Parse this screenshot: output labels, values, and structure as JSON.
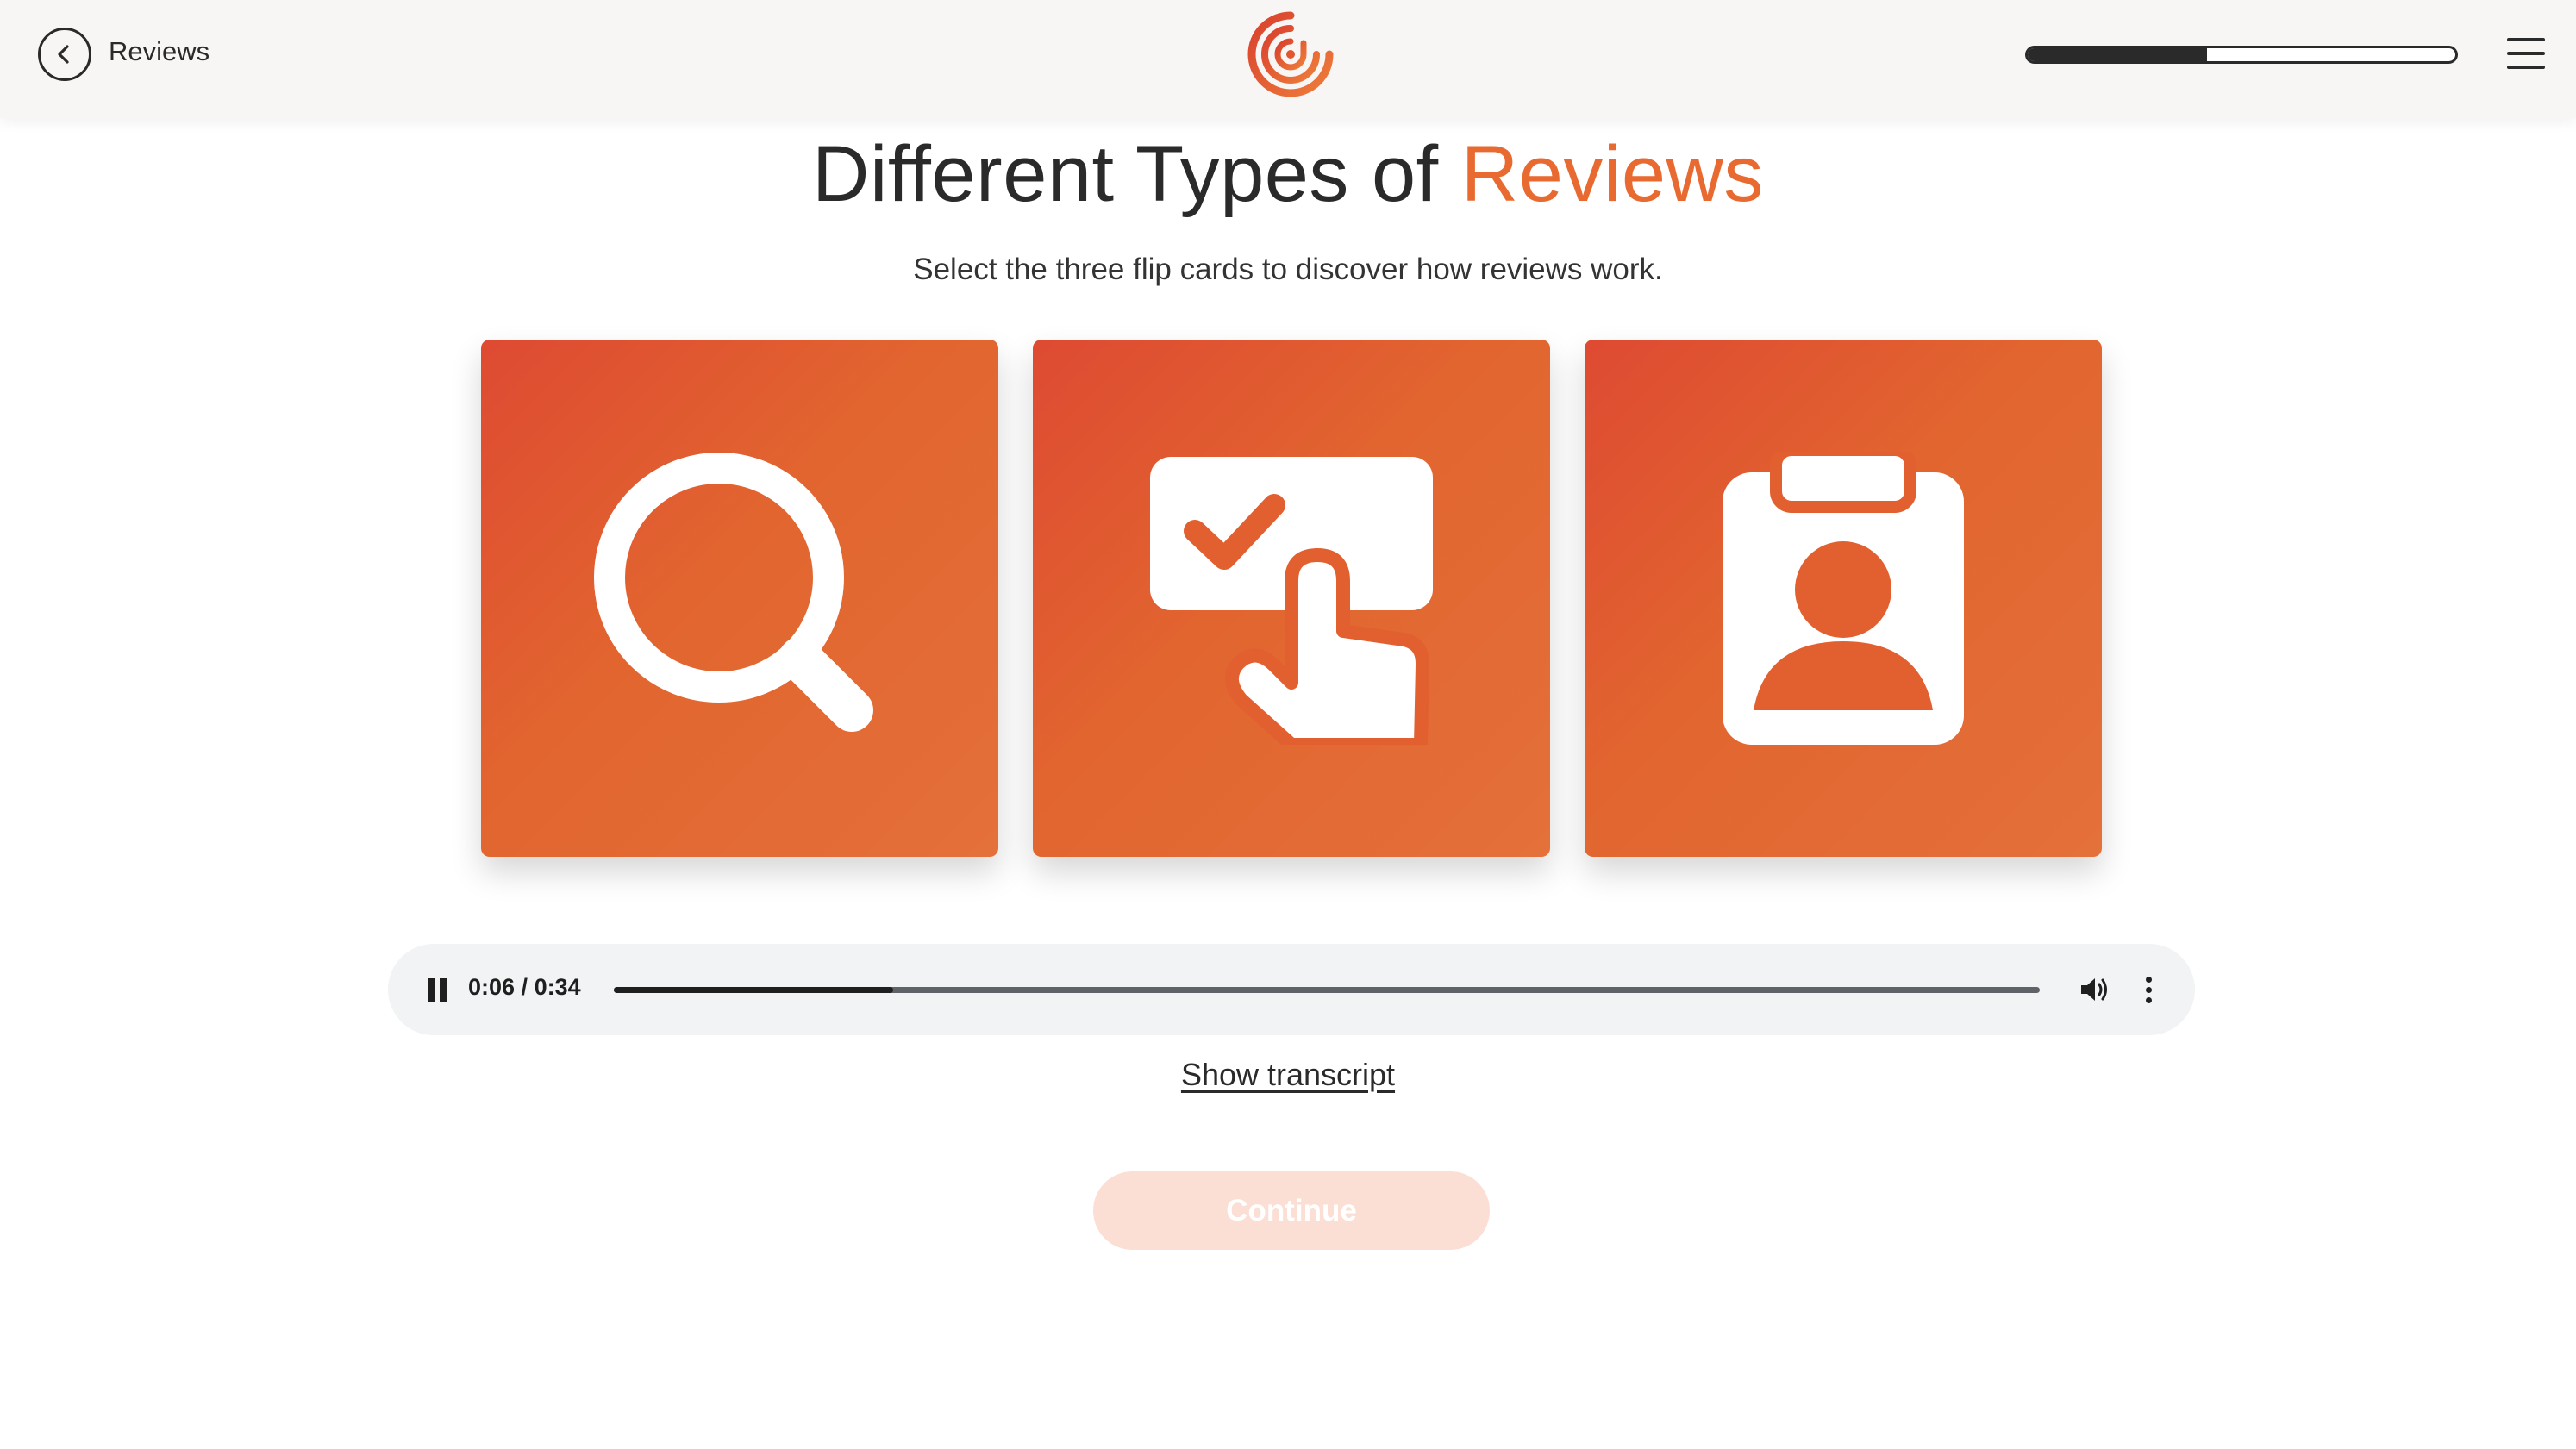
{
  "header": {
    "back_label": "Reviews",
    "logo_icon": "swirl-logo-icon",
    "progress_fraction": 0.42,
    "back_icon": "chevron-left-icon",
    "menu_icon": "hamburger-menu-icon"
  },
  "main": {
    "title_prefix": "Different Types of ",
    "title_accent": "Reviews",
    "subtitle": "Select the three flip cards to discover how reviews work.",
    "cards": [
      {
        "icon": "magnifying-glass-icon"
      },
      {
        "icon": "checkbox-tap-icon"
      },
      {
        "icon": "clipboard-person-icon"
      }
    ]
  },
  "audio": {
    "current_time": "0:06",
    "separator": " / ",
    "duration": "0:34",
    "played_fraction": 0.196,
    "pause_icon": "pause-icon",
    "volume_icon": "volume-icon",
    "more_icon": "more-vertical-icon"
  },
  "transcript_link": "Show transcript",
  "continue_label": "Continue",
  "colors": {
    "accent": "#e86a30",
    "card_gradient_start": "#de4a32",
    "card_gradient_end": "#e4703a",
    "header_background": "#f7f6f4",
    "continue_disabled": "#fbdfd4"
  }
}
